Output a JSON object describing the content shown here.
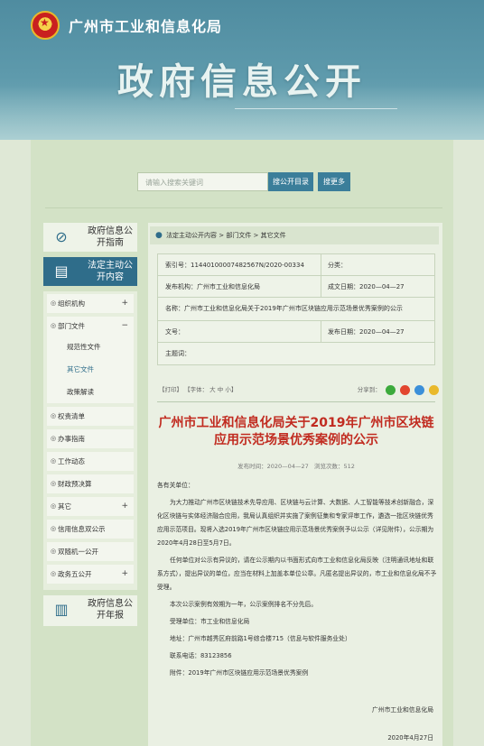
{
  "header": {
    "org_name": "广州市工业和信息化局",
    "banner_title": "政府信息公开"
  },
  "search": {
    "placeholder": "请输入搜索关键词",
    "search_label": "搜公开目录",
    "more_label": "搜更多"
  },
  "sidebar": {
    "guide": "政府信息公开指南",
    "statutory": "法定主动公开内容",
    "annual_report": "政府信息公开年报",
    "items": [
      {
        "label": "组织机构",
        "toggle": "+"
      },
      {
        "label": "部门文件",
        "toggle": "−"
      },
      {
        "label": "权责清单",
        "toggle": ""
      },
      {
        "label": "办事指南",
        "toggle": ""
      },
      {
        "label": "工作动态",
        "toggle": ""
      },
      {
        "label": "财政预决算",
        "toggle": ""
      },
      {
        "label": "其它",
        "toggle": "+"
      },
      {
        "label": "信用信息双公示",
        "toggle": ""
      },
      {
        "label": "双随机一公开",
        "toggle": ""
      },
      {
        "label": "政务五公开",
        "toggle": "+"
      }
    ],
    "subitems": [
      "规范性文件",
      "其它文件",
      "政策解读"
    ]
  },
  "breadcrumb": "法定主动公开内容 > 部门文件 > 其它文件",
  "meta": {
    "index_label": "索引号：",
    "index_value": "11440100007482567N/2020-00334",
    "category_label": "分类：",
    "category_value": "",
    "publisher_label": "发布机构：",
    "publisher_value": "广州市工业和信息化局",
    "created_label": "成文日期：",
    "created_value": "2020—04—27",
    "name_label": "名称：",
    "name_value": "广州市工业和信息化局关于2019年广州市区块链应用示范场景优秀案例的公示",
    "docno_label": "文号：",
    "docno_value": "",
    "pubdate_label": "发布日期：",
    "pubdate_value": "2020—04—27",
    "subject_label": "主题词：",
    "subject_value": ""
  },
  "toolbar": {
    "print": "【打印】",
    "fontsize_label": "【字体：",
    "size_large": "大",
    "size_mid": "中",
    "size_small": "小】",
    "share_label": "分享到："
  },
  "share_colors": [
    "#3caa3c",
    "#e2462f",
    "#3b8fd9",
    "#e9b92b"
  ],
  "article": {
    "title": "广州市工业和信息化局关于2019年广州市区块链应用示范场景优秀案例的公示",
    "publish_time_label": "发布时间：",
    "publish_time": "2020—04—27",
    "views_label": "浏览次数：",
    "views": "512",
    "salutation": "各有关单位：",
    "para1": "为大力推动广州市区块链技术先导应用、区块链与云计算、大数据、人工智能等技术创新融合，深化区块链与实体经济融合应用，我局认真组织并实施了案例征集和专家评审工作，遴选一批区块链优秀应用示范项目。现将入选2019年广州市区块链应用示范场景优秀案例予以公示（详见附件），公示期为2020年4月28日至5月7日。",
    "para2": "任何单位对公示有异议的，请在公示期内以书面形式向市工业和信息化局反映（注明通讯地址和联系方式），提出异议的单位，应当在材料上加盖本单位公章。凡匿名提出异议的，市工业和信息化局不予受理。",
    "para3": "本次公示案例有效期为一年，公示案例排名不分先后。",
    "receiver": "受理单位：市工业和信息化局",
    "address": "地址：广州市越秀区府前路1号综合楼715（信息与软件服务业处）",
    "phone": "联系电话：83123856",
    "attachment": "附件：2019年广州市区块链应用示范场景优秀案例",
    "signature": "广州市工业和信息化局",
    "date": "2020年4月27日"
  }
}
